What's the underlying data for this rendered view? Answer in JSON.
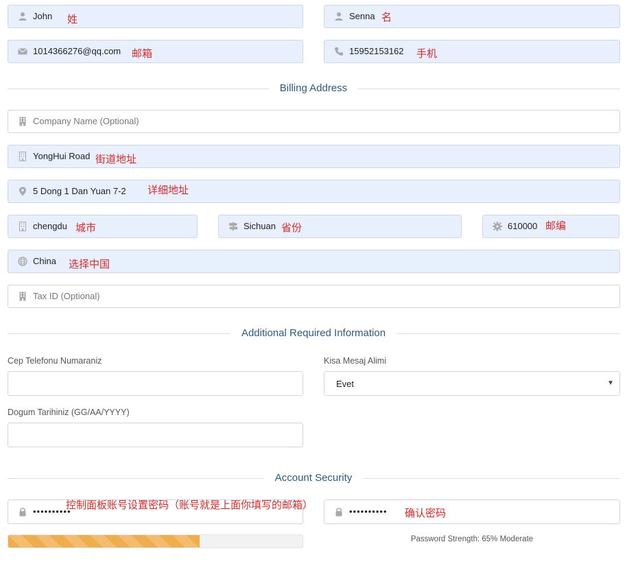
{
  "personal": {
    "first_name": {
      "value": "John",
      "note": "姓"
    },
    "last_name": {
      "value": "Senna",
      "note": "名"
    },
    "email": {
      "value": "1014366276@qq.com",
      "note": "邮箱"
    },
    "phone": {
      "value": "15952153162",
      "note": "手机"
    }
  },
  "billing": {
    "title": "Billing Address",
    "company": {
      "placeholder": "Company Name (Optional)"
    },
    "street": {
      "value": "YongHui Road",
      "note": "街道地址"
    },
    "address2": {
      "value": "5 Dong 1 Dan Yuan 7-2",
      "note": "详细地址"
    },
    "city": {
      "value": "chengdu",
      "note": "城市"
    },
    "state": {
      "value": "Sichuan",
      "note": "省份"
    },
    "postcode": {
      "value": "610000",
      "note": "邮编"
    },
    "country": {
      "value": "China",
      "note": "选择中国"
    },
    "tax_id": {
      "placeholder": "Tax ID (Optional)"
    }
  },
  "additional": {
    "title": "Additional Required Information",
    "phone_label": "Cep Telefonu Numaraniz",
    "sms_label": "Kisa Mesaj Alimi",
    "sms_value": "Evet",
    "dob_label": "Dogum Tarihiniz (GG/AA/YYYY)"
  },
  "security": {
    "title": "Account Security",
    "password": {
      "value": "••••••••••",
      "note": "控制面板账号设置密码（账号就是上面你填写的邮箱）"
    },
    "confirm": {
      "value": "••••••••••",
      "note": "确认密码"
    },
    "strength_percent": 65,
    "strength_text": "Password Strength: 65% Moderate"
  },
  "icons": {
    "user": "user-icon",
    "envelope": "envelope-icon",
    "phone": "phone-icon",
    "building": "building-icon",
    "map_marker": "map-marker-icon",
    "signpost": "signpost-icon",
    "cog": "cog-icon",
    "globe": "globe-icon",
    "lock": "lock-icon"
  },
  "colors": {
    "autofill_bg": "#e8f0fe",
    "note_red": "#d42a2a",
    "section_title": "#2a5a7f",
    "progress_bar": "#f0ad4e"
  }
}
